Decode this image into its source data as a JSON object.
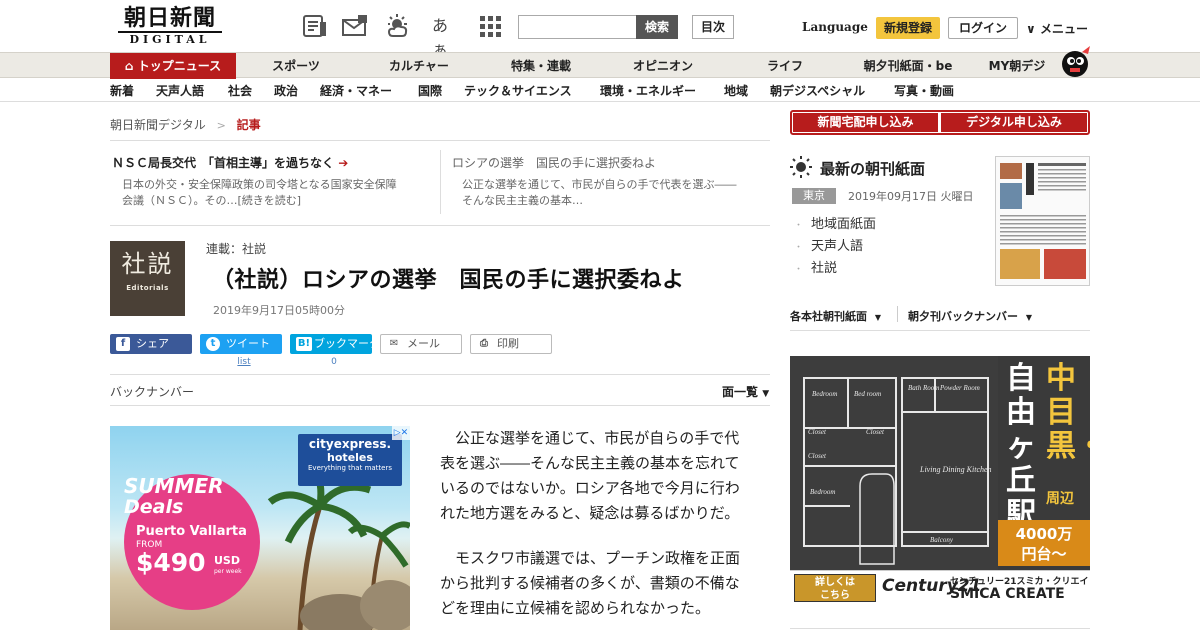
{
  "header": {
    "logo_jp": "朝日新聞",
    "logo_en": "DIGITAL",
    "icons": [
      "newspaper-icon",
      "mail-icon",
      "weather-icon",
      "text-size-icon",
      "app-grid-icon"
    ],
    "text_size_label": "あぁ",
    "search": {
      "placeholder": "",
      "button_label": "検索"
    },
    "toc_label": "目次",
    "language_label": "Language",
    "register_label": "新規登録",
    "login_label": "ログイン",
    "menu_label": "メニュー"
  },
  "main_nav": [
    "トップニュース",
    "スポーツ",
    "カルチャー",
    "特集・連載",
    "オピニオン",
    "ライフ",
    "朝夕刊紙面・be",
    "MY朝デジ"
  ],
  "sub_nav": [
    "新着",
    "天声人語",
    "社会",
    "政治",
    "経済・マネー",
    "国際",
    "テック＆サイエンス",
    "環境・エネルギー",
    "地域",
    "朝デジスペシャル",
    "写真・動画"
  ],
  "breadcrumb": {
    "home": "朝日新聞デジタル",
    "separator": ">",
    "current": "記事"
  },
  "related": [
    {
      "title": "ＮＳＣ局長交代　「首相主導」を過ちなく",
      "arrow": "➔",
      "body_line1": "日本の外交・安全保障政策の司令塔となる国家安全保障",
      "body_line2": "会議（ＮＳＣ）。その…[続きを読む]"
    },
    {
      "title": "ロシアの選挙　国民の手に選択委ねよ",
      "body_line1": "公正な選挙を通じて、市民が自らの手で代表を選ぶ――",
      "body_line2": "そんな民主主義の基本…"
    }
  ],
  "editorial": {
    "logo_kanji": "社説",
    "logo_en": "Editorials",
    "series": "連載：社説",
    "title": "（社説）ロシアの選挙　国民の手に選択委ねよ",
    "date": "2019年9月17日05時00分"
  },
  "share": {
    "facebook": {
      "icon_glyph": "f",
      "label": "シェア"
    },
    "twitter": {
      "icon_glyph": "t",
      "label": "ツイート",
      "count": "list"
    },
    "hatena": {
      "icon_glyph": "B!",
      "label": "ブックマーク",
      "count": "0"
    },
    "mail": {
      "label": "メール"
    },
    "print": {
      "label": "印刷"
    }
  },
  "back_number": {
    "label": "バックナンバー",
    "list_label": "面一覧",
    "caret": "▼"
  },
  "ad_left": {
    "brand_line1": "cityexpress.",
    "brand_line2": "hoteles",
    "brand_tagline": "Everything that matters",
    "summer": "SUMMER",
    "deals": "Deals",
    "destination": "Puerto Vallarta",
    "from": "FROM",
    "price": "$490",
    "currency": "USD",
    "per": "per week",
    "close_glyph": "▷✕"
  },
  "article": {
    "paragraphs": [
      "公正な選挙を通じて、市民が自らの手で代表を選ぶ――そんな民主主義の基本を忘れているのではないか。ロシア各地で今月に行われた地方選をみると、疑念は募るばかりだ。",
      "モスクワ市議選では、プーチン政権を正面から批判する候補者の多くが、書類の不備などを理由に立候補を認められなかった。"
    ]
  },
  "right": {
    "subscribe_paper": "新聞宅配申し込み",
    "subscribe_digital": "デジタル申し込み",
    "latest_title": "最新の朝刊紙面",
    "region": "東京",
    "paper_date": "2019年09月17日 火曜日",
    "paper_links": [
      "地域面紙面",
      "天声人語",
      "社説"
    ],
    "bullet": "・",
    "nav_left": "各本社朝刊紙面",
    "nav_right": "朝夕刊バックナンバー",
    "caret": "▼"
  },
  "ad_right": {
    "vtext_line1": "自由ヶ丘駅",
    "vtext_line2": "中目黒・",
    "vtext_area": "周辺",
    "price_line1": "4000万",
    "price_line2": "円台～",
    "more_line1": "詳しくは",
    "more_line2": "こちら",
    "brand": "Century21",
    "brand_sub": "センチュリー21スミカ・クリエイト",
    "brand_en": "SMICA CREATE",
    "plan_labels": [
      "Bedroom",
      "Bed room",
      "Closet",
      "Closet",
      "Bath Room",
      "Powder Room",
      "Closet",
      "Bedroom",
      "Living Dining Kitchen",
      "Balcony"
    ]
  },
  "colors": {
    "accent_red": "#b71c1c",
    "nav_bg": "#eceae4",
    "register_yellow": "#f3c53d",
    "facebook": "#3b5998",
    "twitter": "#1da1f2",
    "hatena": "#00a4de"
  }
}
